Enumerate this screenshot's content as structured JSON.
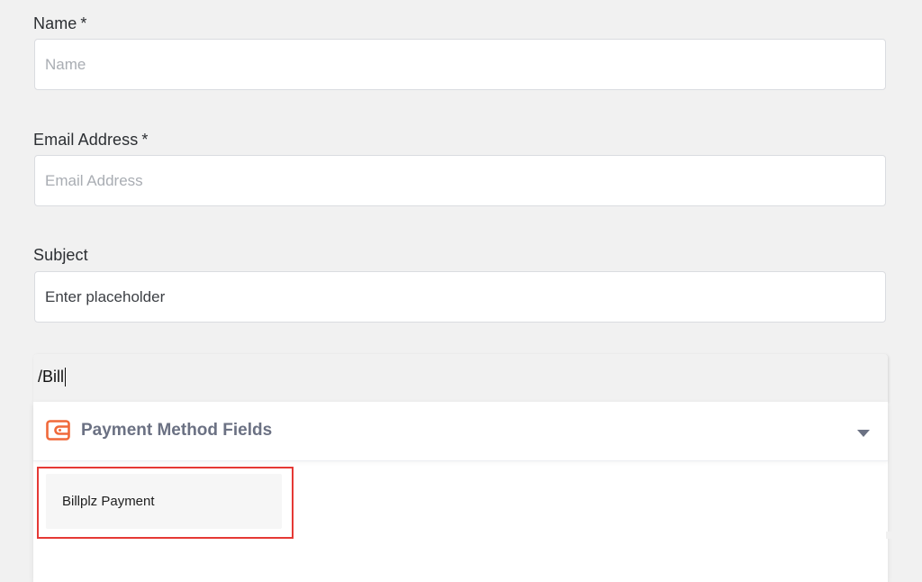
{
  "form": {
    "name": {
      "label": "Name",
      "required_mark": "*",
      "placeholder": "Name",
      "value": ""
    },
    "email": {
      "label": "Email Address",
      "required_mark": "*",
      "placeholder": "Email Address",
      "value": ""
    },
    "subject": {
      "label": "Subject",
      "placeholder": "Enter placeholder",
      "value": ""
    }
  },
  "block_search": {
    "query": "/Bill"
  },
  "dropdown": {
    "category_title": "Payment Method Fields",
    "category_icon": "wallet-icon",
    "expand_icon": "chevron-down-icon",
    "items": [
      {
        "label": "Billplz Payment"
      }
    ]
  },
  "colors": {
    "icon_accent": "#f0693a",
    "highlight": "#e53935",
    "category_text": "#6b7183",
    "background": "#f1f1f1"
  }
}
